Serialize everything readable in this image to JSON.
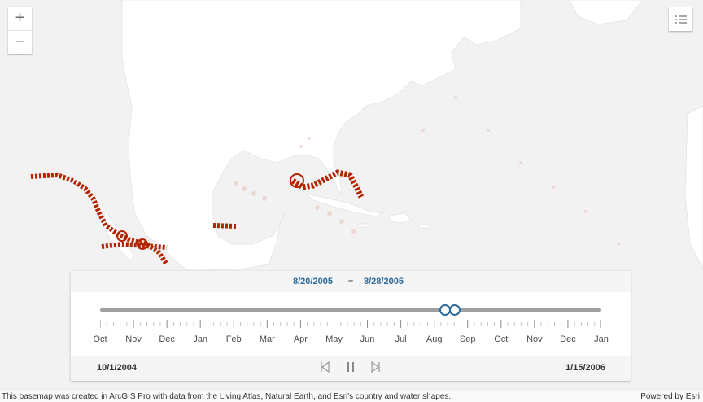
{
  "map": {
    "zoom_in_icon": "plus-icon",
    "zoom_out_icon": "minus-icon",
    "layer_list_icon": "list-icon",
    "colors": {
      "land": "#ffffff",
      "water": "#f2f2f2",
      "track": "#b32400",
      "faint_track": "#e8c7bd",
      "border": "#e3e3e3"
    }
  },
  "time_slider": {
    "current_start": "8/20/2005",
    "separator": "–",
    "current_end": "8/28/2005",
    "full_start": "10/1/2004",
    "full_end": "1/15/2006",
    "months": [
      "Oct",
      "Nov",
      "Dec",
      "Jan",
      "Feb",
      "Mar",
      "Apr",
      "May",
      "Jun",
      "Jul",
      "Aug",
      "Sep",
      "Oct",
      "Nov",
      "Dec",
      "Jan"
    ],
    "handle_positions": [
      0.689,
      0.707
    ],
    "icons": {
      "previous": "step-back-icon",
      "play_pause": "pause-icon",
      "next": "step-forward-icon"
    }
  },
  "attribution": {
    "text": "This basemap was created in ArcGIS Pro with data from the Living Atlas, Natural Earth, and Esri's country and water shapes.",
    "powered_by": "Powered by Esri"
  }
}
